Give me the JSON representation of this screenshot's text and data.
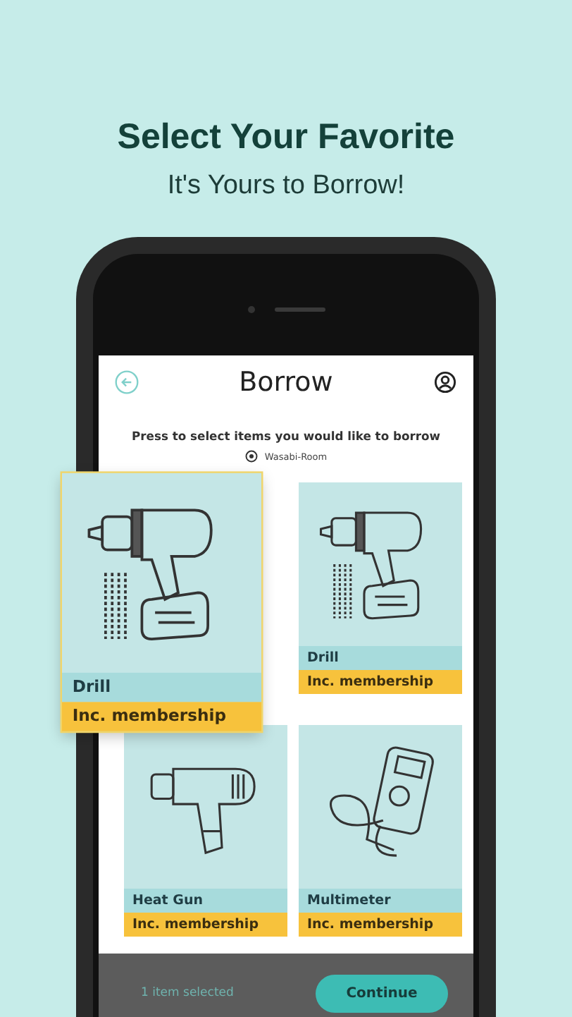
{
  "headline": "Select Your Favorite",
  "subheadline": "It's Yours to Borrow!",
  "app": {
    "title": "Borrow",
    "instruction": "Press to select items you would like to borrow",
    "location": "Wasabi-Room",
    "items": [
      {
        "kind": "drill",
        "name": "Drill",
        "tag": "Inc. membership",
        "selected": true
      },
      {
        "kind": "drill",
        "name": "Drill",
        "tag": "Inc. membership",
        "selected": false
      },
      {
        "kind": "heat-gun",
        "name": "Heat Gun",
        "tag": "Inc. membership",
        "selected": false
      },
      {
        "kind": "multimeter",
        "name": "Multimeter",
        "tag": "Inc. membership",
        "selected": false
      }
    ],
    "selection_summary": "1 item selected",
    "continue_button": "Continue"
  }
}
